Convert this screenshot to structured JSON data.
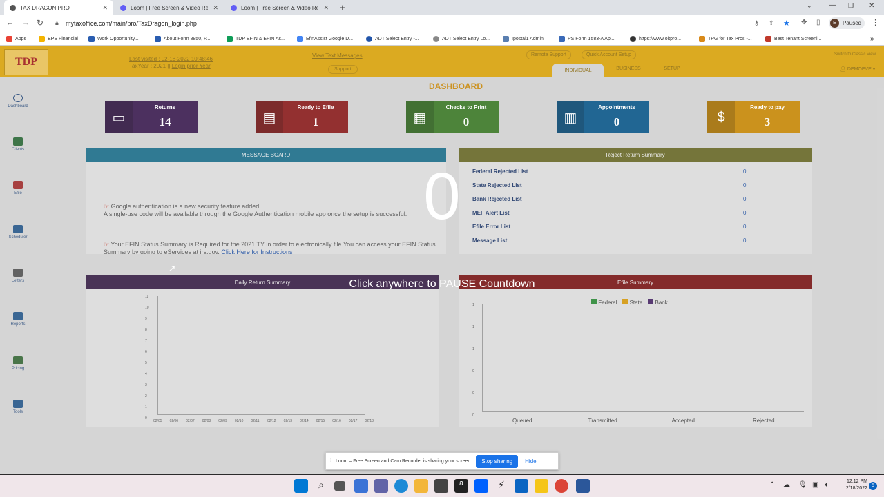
{
  "browser": {
    "tabs": [
      {
        "title": "TAX DRAGON PRO",
        "active": true
      },
      {
        "title": "Loom | Free Screen & Video Rec",
        "active": false
      },
      {
        "title": "Loom | Free Screen & Video Rec",
        "active": false
      }
    ],
    "url": "mytaxoffice.com/main/pro/TaxDragon_login.php",
    "profile_initial": "E",
    "profile_status": "Paused",
    "bookmarks": [
      "Apps",
      "EPS Financial",
      "Work Opportunity...",
      "About Form 8850, P...",
      "TDP EFIN & EFIN As...",
      "EfinAssist Google D...",
      "ADT Select Entry -...",
      "ADT Select Entry Lo...",
      "Ipostal1 Admin",
      "PS Form 1583-A Ap...",
      "https://www.oltpro...",
      "TPG for Tax Pros -...",
      "Best Tenant Screeni..."
    ]
  },
  "app": {
    "last_visited": "Last visited : 02-18-2022 10:48:46",
    "tax_year": "TaxYear : 2021",
    "login_prior": "Login prior Year",
    "view_text": "View Text Messages",
    "support": "Support",
    "remote_support": "Remote Support",
    "quick_account": "Quick Account Setup",
    "switch": "Switch to Classic View",
    "user": "DEMOEVE",
    "nav": [
      "INDIVIDUAL",
      "BUSINESS",
      "SETUP"
    ],
    "dashboard_title": "DASHBOARD",
    "sidebar": [
      "Dashboard",
      "Clients",
      "Efile",
      "Scheduler",
      "Letters",
      "Reports",
      "Pricing",
      "Tools"
    ],
    "cards": [
      {
        "label": "Returns",
        "value": "14",
        "color": "#3d1f52",
        "icon": "folder-icon"
      },
      {
        "label": "Ready to Efile",
        "value": "1",
        "color": "#8a1f1f",
        "icon": "clipboard-icon"
      },
      {
        "label": "Checks to Print",
        "value": "0",
        "color": "#3e7a2a",
        "icon": "printer-icon"
      },
      {
        "label": "Appointments",
        "value": "0",
        "color": "#0f5a8a",
        "icon": "calendar-icon"
      },
      {
        "label": "Ready to pay",
        "value": "3",
        "color": "#c7890a",
        "icon": "dollar-icon"
      }
    ],
    "message_board": {
      "title": "MESSAGE BOARD",
      "msg1": "Google authentication is a new security feature added.",
      "msg1b": "A single-use code will be available through the Google Authentication mobile app once the setup is successful.",
      "msg2": "Your EFIN Status Summary is Required for the 2021 TY in order to electronically file.You can access your EFIN Status Summary by going to eServices at irs.gov.",
      "msg2_link": "Click Here for Instructions"
    },
    "reject_summary": {
      "title": "Reject Return Summary",
      "rows": [
        {
          "label": "Federal Rejected List",
          "value": "0"
        },
        {
          "label": "State Rejected List",
          "value": "0"
        },
        {
          "label": "Bank Rejected List",
          "value": "0"
        },
        {
          "label": "MEF Alert List",
          "value": "0"
        },
        {
          "label": "Efile Error List",
          "value": "0"
        },
        {
          "label": "Message List",
          "value": "0"
        }
      ]
    },
    "daily_summary": {
      "title": "Daily Return Summary",
      "yticks": [
        "11",
        "10",
        "9",
        "8",
        "7",
        "6",
        "5",
        "4",
        "3",
        "2",
        "1",
        "0"
      ],
      "xticks": [
        "02/05",
        "02/06",
        "02/07",
        "02/08",
        "02/09",
        "02/10",
        "02/11",
        "02/12",
        "02/13",
        "02/14",
        "02/15",
        "02/16",
        "02/17",
        "02/18"
      ]
    },
    "efile_summary": {
      "title": "Efile Summary",
      "legend": [
        {
          "name": "Federal",
          "color": "#2f8a3a"
        },
        {
          "name": "State",
          "color": "#d49a12"
        },
        {
          "name": "Bank",
          "color": "#4a2a68"
        }
      ],
      "yticks": [
        "1",
        "1",
        "1",
        "0",
        "0",
        "0"
      ],
      "categories": [
        "Queued",
        "Transmitted",
        "Accepted",
        "Rejected"
      ]
    }
  },
  "overlay": {
    "countdown": "0",
    "pause_text": "Click anywhere to PAUSE Countdown"
  },
  "loom": {
    "message": "Loom – Free Screen and Cam Recorder is sharing your screen.",
    "stop": "Stop sharing",
    "hide": "Hide"
  },
  "taskbar": {
    "time": "12:12 PM",
    "date": "2/18/2022",
    "notif": "5"
  }
}
